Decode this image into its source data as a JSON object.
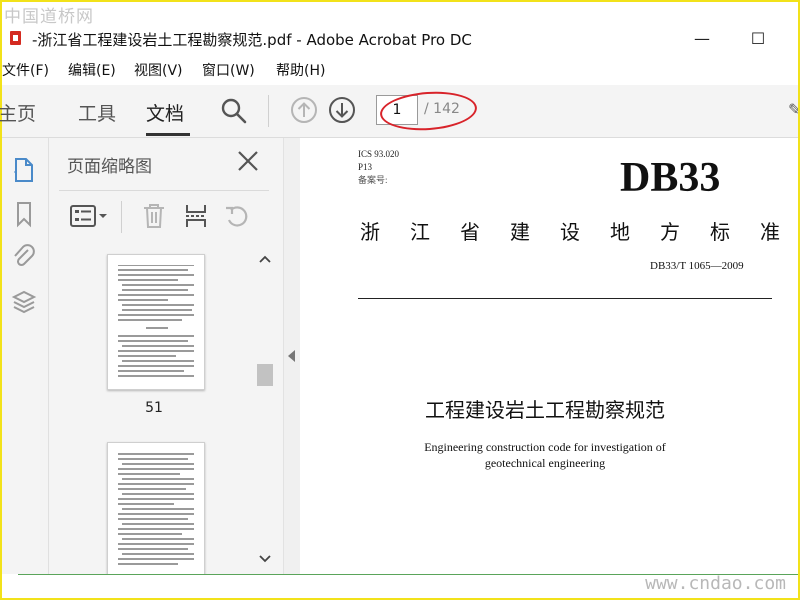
{
  "watermark": {
    "top": "中国道桥网",
    "bottom": "www.cndao.com"
  },
  "window": {
    "title": "-浙江省工程建设岩土工程勘察规范.pdf - Adobe Acrobat Pro DC",
    "minimize": "—",
    "maximize": "☐"
  },
  "menu": {
    "items": [
      "文件(F)",
      "编辑(E)",
      "视图(V)",
      "窗口(W)",
      "帮助(H)"
    ]
  },
  "tabs": {
    "home": "主页",
    "tools": "工具",
    "document": "文档"
  },
  "page_nav": {
    "current": "1",
    "total": "/ 142"
  },
  "left_rail": {
    "icons": [
      "page-thumbnails-icon",
      "bookmark-icon",
      "attachment-icon",
      "layers-icon"
    ]
  },
  "thumbnails_panel": {
    "title": "页面缩略图",
    "tools": [
      "thumbnail-options-icon",
      "delete-icon",
      "extract-pages-icon",
      "rotate-icon"
    ],
    "pages": [
      {
        "number": "51"
      },
      {
        "number": ""
      }
    ]
  },
  "document": {
    "ics": "ICS 93.020",
    "p_code": "P13",
    "record_no": "备案号:",
    "code": "DB33",
    "standard_chars": [
      "浙",
      "江",
      "省",
      "建",
      "设",
      "地",
      "方",
      "标",
      "准"
    ],
    "standard_no": "DB33/T 1065—2009",
    "title_cn": "工程建设岩土工程勘察规范",
    "title_en_line1": "Engineering construction code for investigation of",
    "title_en_line2": "geotechnical engineering"
  },
  "colors": {
    "annotation_circle": "#d8232a",
    "frame": "#f2e21a",
    "acrobat_red": "#d42a20",
    "rail_icon": "#4a8ac9"
  }
}
